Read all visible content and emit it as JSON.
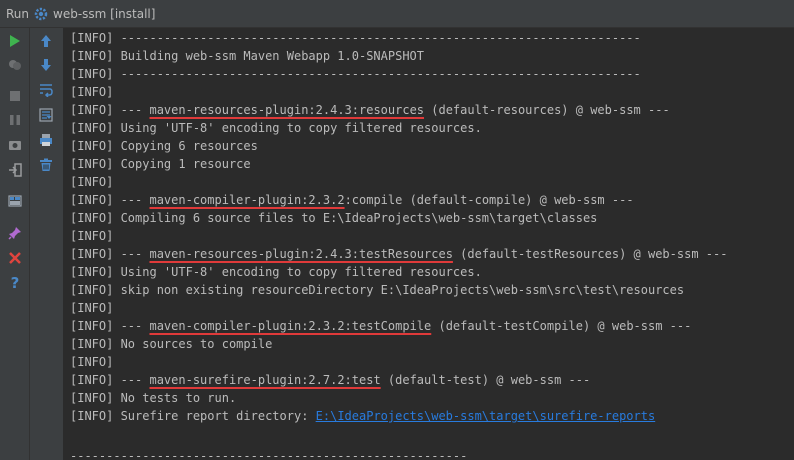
{
  "titlebar": {
    "run_label": "Run",
    "config_name": "web-ssm [install]"
  },
  "toolbar_left": [
    {
      "name": "rerun-icon",
      "color": "#3fb34f"
    },
    {
      "name": "pin-icon",
      "color": "#6e7072"
    },
    {
      "name": "stop-icon",
      "color": "#6e7072"
    },
    {
      "name": "pause-icon",
      "color": "#6e7072"
    },
    {
      "name": "camera-icon",
      "color": "#9a9c9e"
    },
    {
      "name": "login-icon",
      "color": "#9a9c9e"
    },
    {
      "name": "layout-icon",
      "color": "#4a88c7"
    },
    {
      "name": "pin-tab-icon",
      "color": "#b06ad0"
    },
    {
      "name": "close-icon",
      "color": "#e0443e"
    },
    {
      "name": "help-icon",
      "color": "#4a88c7"
    }
  ],
  "toolbar_right": [
    {
      "name": "arrow-up-icon",
      "color": "#4a88c7"
    },
    {
      "name": "arrow-down-icon",
      "color": "#4a88c7"
    },
    {
      "name": "soft-wrap-icon",
      "color": "#4a88c7"
    },
    {
      "name": "scroll-to-end-icon",
      "color": "#4a88c7"
    },
    {
      "name": "print-icon",
      "color": "#4a88c7"
    },
    {
      "name": "trash-icon",
      "color": "#4a88c7"
    }
  ],
  "console": {
    "lines": [
      {
        "segments": [
          {
            "text": "[INFO] ------------------------------------------------------------------------"
          }
        ]
      },
      {
        "segments": [
          {
            "text": "[INFO] Building web-ssm Maven Webapp 1.0-SNAPSHOT"
          }
        ]
      },
      {
        "segments": [
          {
            "text": "[INFO] ------------------------------------------------------------------------"
          }
        ]
      },
      {
        "segments": [
          {
            "text": "[INFO]"
          }
        ]
      },
      {
        "segments": [
          {
            "text": "[INFO] --- "
          },
          {
            "text": "maven-resources-plugin:2.4.3:resources",
            "style": "u"
          },
          {
            "text": " (default-resources) @ web-ssm ---"
          }
        ]
      },
      {
        "segments": [
          {
            "text": "[INFO] Using 'UTF-8' encoding to copy filtered resources."
          }
        ]
      },
      {
        "segments": [
          {
            "text": "[INFO] Copying 6 resources"
          }
        ]
      },
      {
        "segments": [
          {
            "text": "[INFO] Copying 1 resource"
          }
        ]
      },
      {
        "segments": [
          {
            "text": "[INFO]"
          }
        ]
      },
      {
        "segments": [
          {
            "text": "[INFO] --- "
          },
          {
            "text": "maven-compiler-plugin:2.3.2",
            "style": "u"
          },
          {
            "text": ":compile (default-compile) @ web-ssm ---"
          }
        ]
      },
      {
        "segments": [
          {
            "text": "[INFO] Compiling 6 source files to E:\\IdeaProjects\\web-ssm\\target\\classes"
          }
        ]
      },
      {
        "segments": [
          {
            "text": "[INFO]"
          }
        ]
      },
      {
        "segments": [
          {
            "text": "[INFO] --- "
          },
          {
            "text": "maven-resources-plugin:2.4.3:testResources",
            "style": "u"
          },
          {
            "text": " (default-testResources) @ web-ssm ---"
          }
        ]
      },
      {
        "segments": [
          {
            "text": "[INFO] Using 'UTF-8' encoding to copy filtered resources."
          }
        ]
      },
      {
        "segments": [
          {
            "text": "[INFO] skip non existing resourceDirectory E:\\IdeaProjects\\web-ssm\\src\\test\\resources"
          }
        ]
      },
      {
        "segments": [
          {
            "text": "[INFO]"
          }
        ]
      },
      {
        "segments": [
          {
            "text": "[INFO] --- "
          },
          {
            "text": "maven-compiler-plugin:2.3.2:testCompile",
            "style": "u"
          },
          {
            "text": " (default-testCompile) @ web-ssm ---"
          }
        ]
      },
      {
        "segments": [
          {
            "text": "[INFO] No sources to compile"
          }
        ]
      },
      {
        "segments": [
          {
            "text": "[INFO]"
          }
        ]
      },
      {
        "segments": [
          {
            "text": "[INFO] --- "
          },
          {
            "text": "maven-surefire-plugin:2.7.2:test",
            "style": "u"
          },
          {
            "text": " (default-test) @ web-ssm ---"
          }
        ]
      },
      {
        "segments": [
          {
            "text": "[INFO] No tests to run."
          }
        ]
      },
      {
        "segments": [
          {
            "text": "[INFO] Surefire report directory: "
          },
          {
            "text": "E:\\IdeaProjects\\web-ssm\\target\\surefire-reports",
            "style": "link"
          }
        ]
      },
      {
        "segments": [
          {
            "text": ""
          }
        ]
      },
      {
        "segments": [
          {
            "text": "-------------------------------------------------------"
          }
        ]
      }
    ]
  }
}
